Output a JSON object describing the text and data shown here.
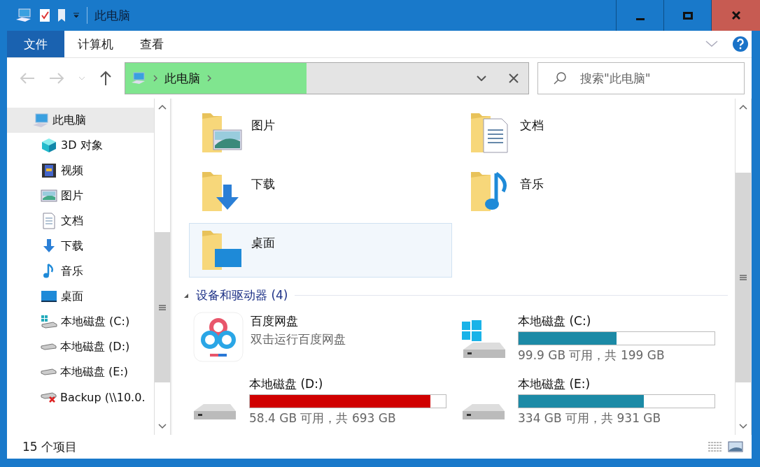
{
  "window": {
    "title": "此电脑"
  },
  "ribbon_tabs": [
    {
      "label": "文件",
      "selected": true
    },
    {
      "label": "计算机",
      "selected": false
    },
    {
      "label": "查看",
      "selected": false
    }
  ],
  "address_bar": {
    "path": "此电脑",
    "level": 0.45
  },
  "search": {
    "placeholder": "搜索\"此电脑\""
  },
  "sidebar": {
    "items": [
      {
        "label": "此电脑",
        "kind": "pc",
        "selected": true,
        "children": [
          {
            "label": "3D 对象",
            "kind": "cube",
            "selected": false
          },
          {
            "label": "视频",
            "kind": "video",
            "selected": false
          },
          {
            "label": "图片",
            "kind": "pictures",
            "selected": false
          },
          {
            "label": "文档",
            "kind": "documents",
            "selected": false
          },
          {
            "label": "下载",
            "kind": "downloads",
            "selected": false
          },
          {
            "label": "音乐",
            "kind": "music",
            "selected": false
          },
          {
            "label": "桌面",
            "kind": "desktop",
            "selected": false
          },
          {
            "label": "本地磁盘 (C:)",
            "kind": "system-drive",
            "selected": false
          },
          {
            "label": "本地磁盘 (D:)",
            "kind": "drive",
            "selected": false
          },
          {
            "label": "本地磁盘 (E:)",
            "kind": "drive",
            "selected": false
          },
          {
            "label": "Backup (\\\\10.0.",
            "kind": "network-drive",
            "selected": false
          }
        ]
      }
    ]
  },
  "folders": [
    {
      "label": "图片",
      "kind": "pictures",
      "selected": false
    },
    {
      "label": "文档",
      "kind": "documents",
      "selected": false
    },
    {
      "label": "下载",
      "kind": "downloads",
      "selected": false
    },
    {
      "label": "音乐",
      "kind": "music",
      "selected": false
    },
    {
      "label": "桌面",
      "kind": "desktop",
      "selected": true
    }
  ],
  "devices_section": {
    "title": "设备和驱动器 (4)",
    "expanded": true
  },
  "devices": [
    {
      "kind": "app",
      "name": "百度网盘",
      "subtitle": "双击运行百度网盘"
    },
    {
      "kind": "system-drive",
      "name": "本地磁盘 (C:)",
      "level": 0.5,
      "color": "#1c8aa6",
      "reading": "99.9 GB 可用，共 199 GB"
    },
    {
      "kind": "drive",
      "name": "本地磁盘 (D:)",
      "level": 0.92,
      "color": "#d00000",
      "reading": "58.4 GB 可用，共 693 GB"
    },
    {
      "kind": "drive",
      "name": "本地磁盘 (E:)",
      "level": 0.64,
      "color": "#1c8aa6",
      "reading": "334 GB 可用，共 931 GB"
    }
  ],
  "status_bar": {
    "item_count": "15 个项目"
  }
}
